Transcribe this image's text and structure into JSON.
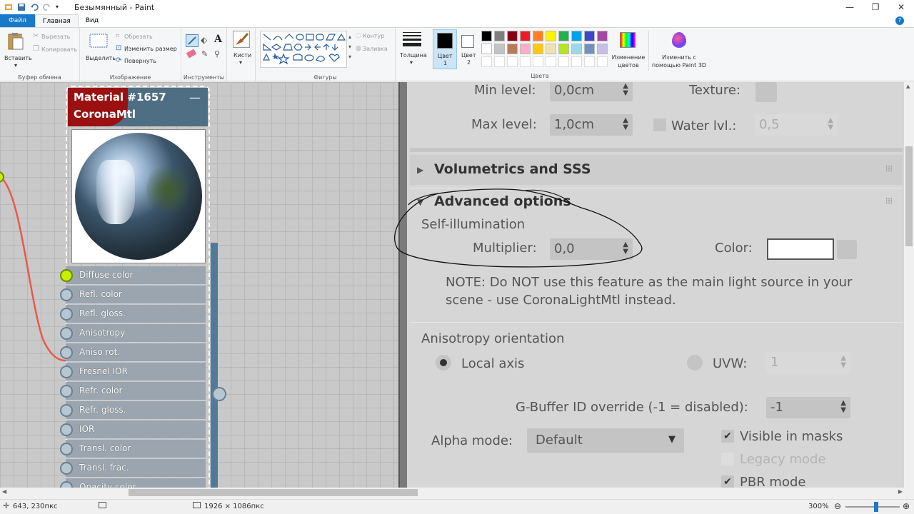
{
  "window": {
    "title": "Безымянный - Paint"
  },
  "tabs": {
    "file": "Файл",
    "home": "Главная",
    "view": "Вид"
  },
  "ribbon": {
    "clipboard": {
      "paste": "Вставить",
      "cut": "Вырезать",
      "copy": "Копировать",
      "label": "Буфер обмена"
    },
    "image": {
      "select": "Выделить",
      "crop": "Обрезать",
      "resize": "Изменить размер",
      "rotate": "Повернуть",
      "label": "Изображение"
    },
    "tools": {
      "label": "Инструменты",
      "text_tool": "A"
    },
    "brushes": {
      "label": "Кисти"
    },
    "shapes": {
      "outline": "Контур",
      "fill": "Заливка",
      "label": "Фигуры"
    },
    "thickness": {
      "label": "Толщина"
    },
    "color1": {
      "label": "Цвет",
      "num": "1"
    },
    "color2": {
      "label": "Цвет",
      "num": "2"
    },
    "colors": {
      "label": "Цвета",
      "edit": "Изменение цветов",
      "palette_row1": [
        "#000000",
        "#7f7f7f",
        "#880015",
        "#ed1c24",
        "#ff7f27",
        "#fff200",
        "#22b14c",
        "#00a2e8",
        "#3f48cc",
        "#a349a4"
      ],
      "palette_row2": [
        "#ffffff",
        "#c3c3c3",
        "#b97a57",
        "#ffaec9",
        "#ffc90e",
        "#efe4b0",
        "#b5e61d",
        "#99d9ea",
        "#7092be",
        "#c8bfe7"
      ]
    },
    "paint3d": {
      "label": "Изменить с помощью Paint 3D"
    }
  },
  "node": {
    "title_line1": "Material #1657",
    "title_line2": "CoronaMtl",
    "minimize": "—",
    "slots": [
      "Diffuse color",
      "Refl. color",
      "Refl. gloss.",
      "Anisotropy",
      "Aniso rot.",
      "Fresnel IOR",
      "Refr. color",
      "Refr. gloss.",
      "IOR",
      "Transl. color",
      "Transl. frac.",
      "Opacity color"
    ]
  },
  "panel": {
    "min_level_label": "Min level:",
    "min_level_value": "0,0cm",
    "texture_label": "Texture:",
    "max_level_label": "Max level:",
    "max_level_value": "1,0cm",
    "water_label": "Water lvl.:",
    "water_value": "0,5",
    "volumetrics": "Volumetrics and SSS",
    "advanced": "Advanced options",
    "self_illum": "Self-illumination",
    "multiplier_label": "Multiplier:",
    "multiplier_value": "0,0",
    "color_label": "Color:",
    "note_line1": "NOTE: Do NOT use this feature as the main light source in your",
    "note_line2": "scene - use CoronaLightMtl instead.",
    "aniso_orient": "Anisotropy orientation",
    "local_axis": "Local axis",
    "uvw": "UVW:",
    "uvw_value": "1",
    "gbuffer_label": "G-Buffer ID override (-1 = disabled):",
    "gbuffer_value": "-1",
    "alpha_label": "Alpha mode:",
    "alpha_value": "Default",
    "visible_masks": "Visible in masks",
    "legacy_mode": "Legacy mode",
    "pbr_mode": "PBR mode"
  },
  "status": {
    "cursor": "643, 230пкс",
    "size": "1926 × 1086пкс",
    "zoom": "300%"
  }
}
